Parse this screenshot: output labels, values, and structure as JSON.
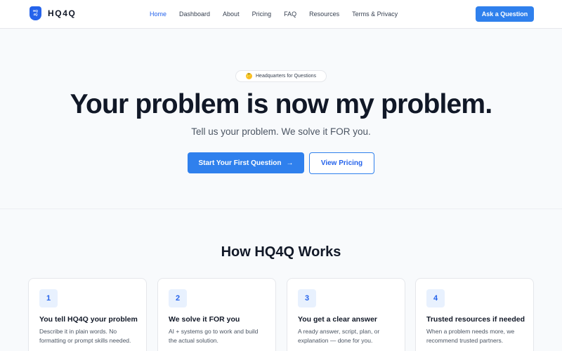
{
  "header": {
    "logo_badge": "HQ\n4Q",
    "logo_text": "HQ4Q",
    "nav": [
      "Home",
      "Dashboard",
      "About",
      "Pricing",
      "FAQ",
      "Resources",
      "Terms & Privacy"
    ],
    "active_nav": "Home",
    "cta_label": "Ask a Question"
  },
  "hero": {
    "pill_emoji": "🤔",
    "pill_text": "Headquarters for Questions",
    "headline": "Your problem is now my problem.",
    "subline": "Tell us your problem. We solve it FOR you.",
    "primary_label": "Start Your First Question",
    "primary_arrow": "→",
    "secondary_label": "View Pricing"
  },
  "how": {
    "title": "How HQ4Q Works",
    "cards": [
      {
        "num": "1",
        "title": "You tell HQ4Q your problem",
        "desc": "Describe it in plain words. No formatting or prompt skills needed."
      },
      {
        "num": "2",
        "title": "We solve it FOR you",
        "desc": "AI + systems go to work and build the actual solution."
      },
      {
        "num": "3",
        "title": "You get a clear answer",
        "desc": "A ready answer, script, plan, or explanation — done for you."
      },
      {
        "num": "4",
        "title": "Trusted resources if needed",
        "desc": "When a problem needs more, we recommend trusted partners."
      }
    ]
  },
  "colors": {
    "accent": "#2f80ed",
    "accent_text": "#2563eb",
    "number_bg": "#e8f1fe",
    "page_bg": "#f8fafc"
  }
}
